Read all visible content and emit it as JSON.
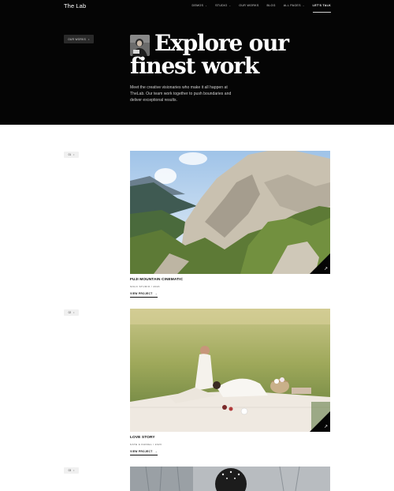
{
  "header": {
    "logo": "The Lab",
    "nav": [
      {
        "label": "DEMOS",
        "dropdown": true
      },
      {
        "label": "STUDIO",
        "dropdown": true
      },
      {
        "label": "OUR WORKS",
        "dropdown": false
      },
      {
        "label": "BLOG",
        "dropdown": false
      },
      {
        "label": "ALL PAGES",
        "dropdown": true
      }
    ],
    "cta": "LET'S TALK"
  },
  "hero": {
    "chip_label": "OUR WORKS",
    "title_line1": "Explore our",
    "title_line2": "finest work",
    "lead": "Meet the creative visionaries who make it all happen at TheLab. Our team work together to push boundaries and deliver exceptional results."
  },
  "works": [
    {
      "index": "01",
      "title": "FUJI MOUNTAIN CINEMATIC",
      "meta": "SOLO STUDIO / 2023",
      "cta": "VIEW PROJECT"
    },
    {
      "index": "02",
      "title": "LOVE STORY",
      "meta": "KATE & DANIEL / 2023",
      "cta": "VIEW PROJECT"
    },
    {
      "index": "03"
    }
  ],
  "colors": {
    "hero_bg": "#050505",
    "page_bg": "#ffffff",
    "text": "#111111"
  }
}
